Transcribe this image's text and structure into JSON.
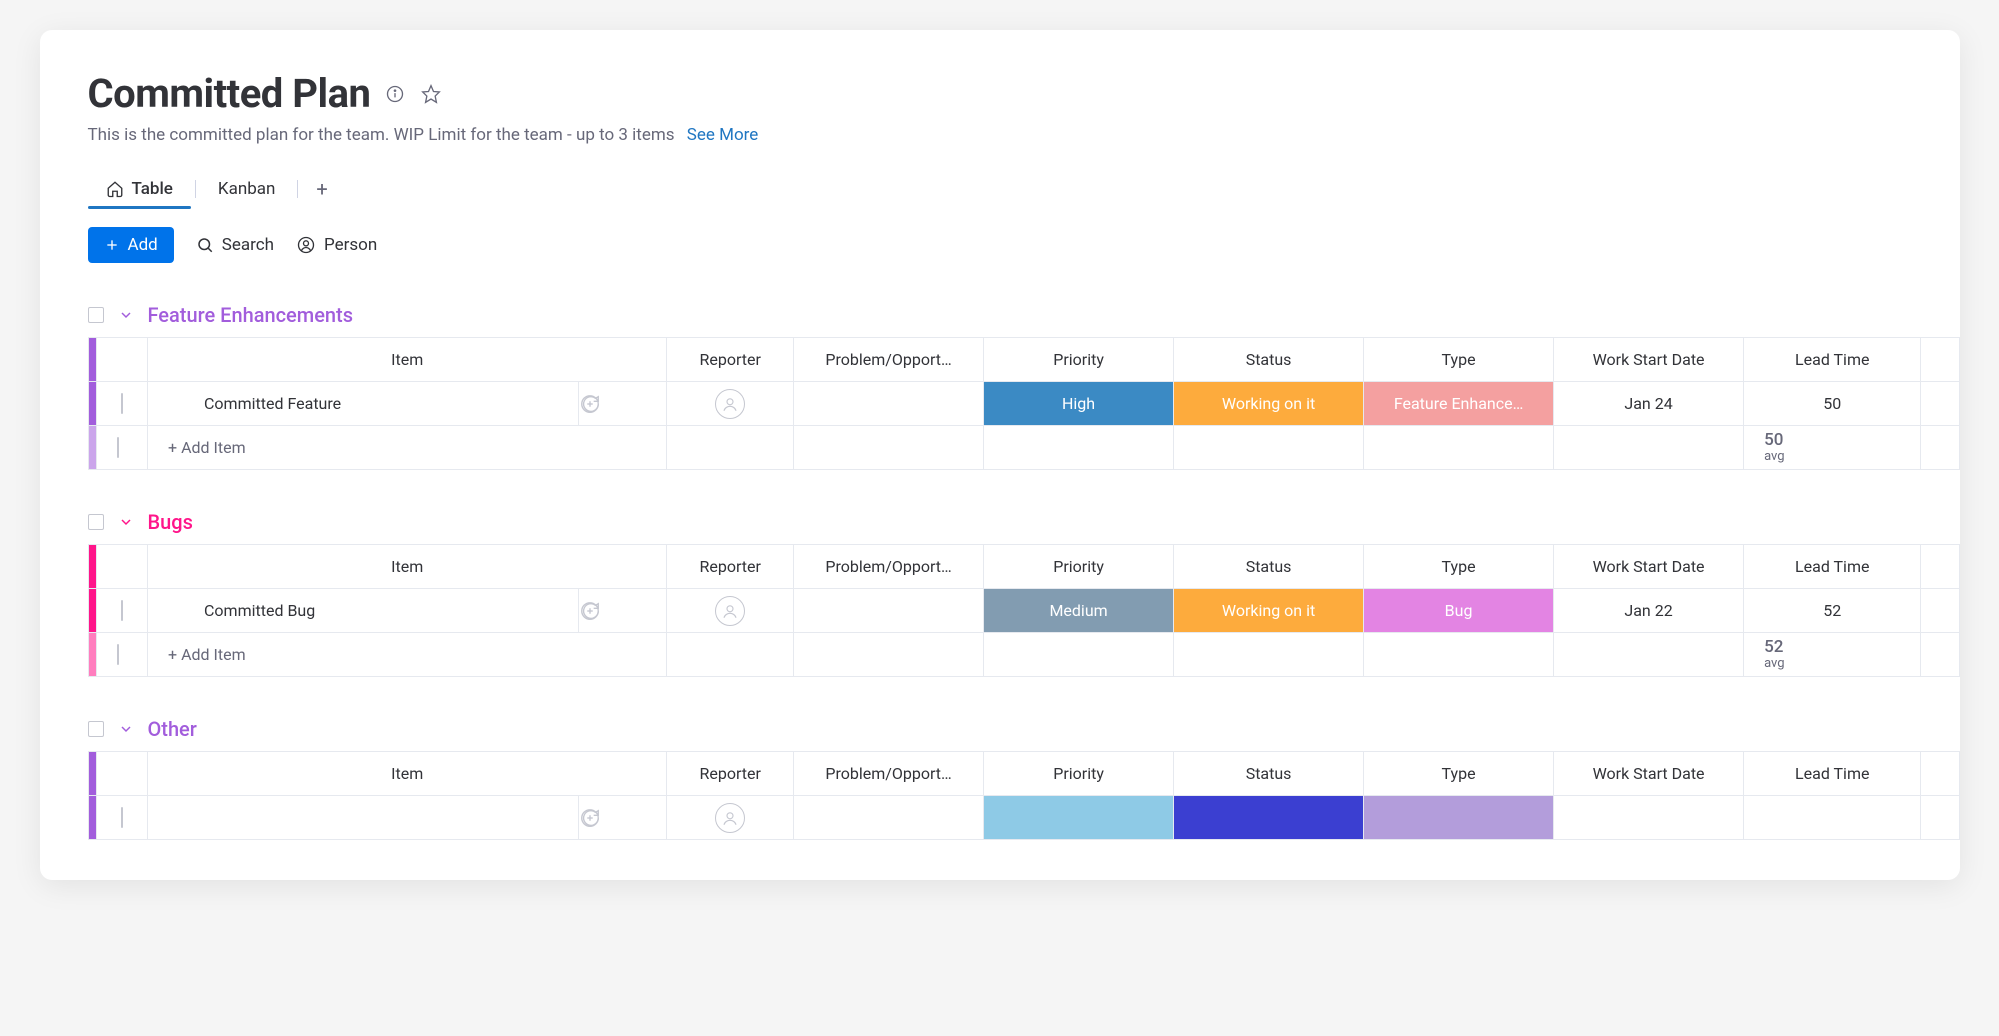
{
  "header": {
    "title": "Committed Plan",
    "description": "This is the committed plan for the team. WIP Limit for the team - up to 3 items",
    "see_more": "See More"
  },
  "tabs": [
    {
      "label": "Table",
      "active": true
    },
    {
      "label": "Kanban",
      "active": false
    }
  ],
  "toolbar": {
    "add_label": "Add",
    "search_label": "Search",
    "person_label": "Person"
  },
  "columns": [
    "Item",
    "Reporter",
    "Problem/Opport…",
    "Priority",
    "Status",
    "Type",
    "Work Start Date",
    "Lead Time"
  ],
  "add_item_label": "+ Add Item",
  "groups": [
    {
      "name": "Feature Enhancements",
      "color": "#a25ddc",
      "rows": [
        {
          "item": "Committed Feature",
          "reporter": "",
          "problem": "",
          "priority": {
            "text": "High",
            "color": "#3b8ac4"
          },
          "status": {
            "text": "Working on it",
            "color": "#fdab3d"
          },
          "type": {
            "text": "Feature Enhance…",
            "color": "#f4a0a0"
          },
          "work_start_date": "Jan 24",
          "lead_time": "50"
        }
      ],
      "summary": {
        "lead_time_value": "50",
        "lead_time_unit": "avg"
      }
    },
    {
      "name": "Bugs",
      "color": "#ff158a",
      "rows": [
        {
          "item": "Committed Bug",
          "reporter": "",
          "problem": "",
          "priority": {
            "text": "Medium",
            "color": "#829cb1"
          },
          "status": {
            "text": "Working on it",
            "color": "#fdab3d"
          },
          "type": {
            "text": "Bug",
            "color": "#e384e3"
          },
          "work_start_date": "Jan 22",
          "lead_time": "52"
        }
      ],
      "summary": {
        "lead_time_value": "52",
        "lead_time_unit": "avg"
      }
    },
    {
      "name": "Other",
      "color": "#a25ddc",
      "rows": [
        {
          "item": "",
          "reporter": "",
          "problem": "",
          "priority": {
            "text": "",
            "color": "#8ecae6"
          },
          "status": {
            "text": "",
            "color": "#3b3fd1"
          },
          "type": {
            "text": "",
            "color": "#b39ddb"
          },
          "work_start_date": "",
          "lead_time": ""
        }
      ],
      "summary": null
    }
  ]
}
